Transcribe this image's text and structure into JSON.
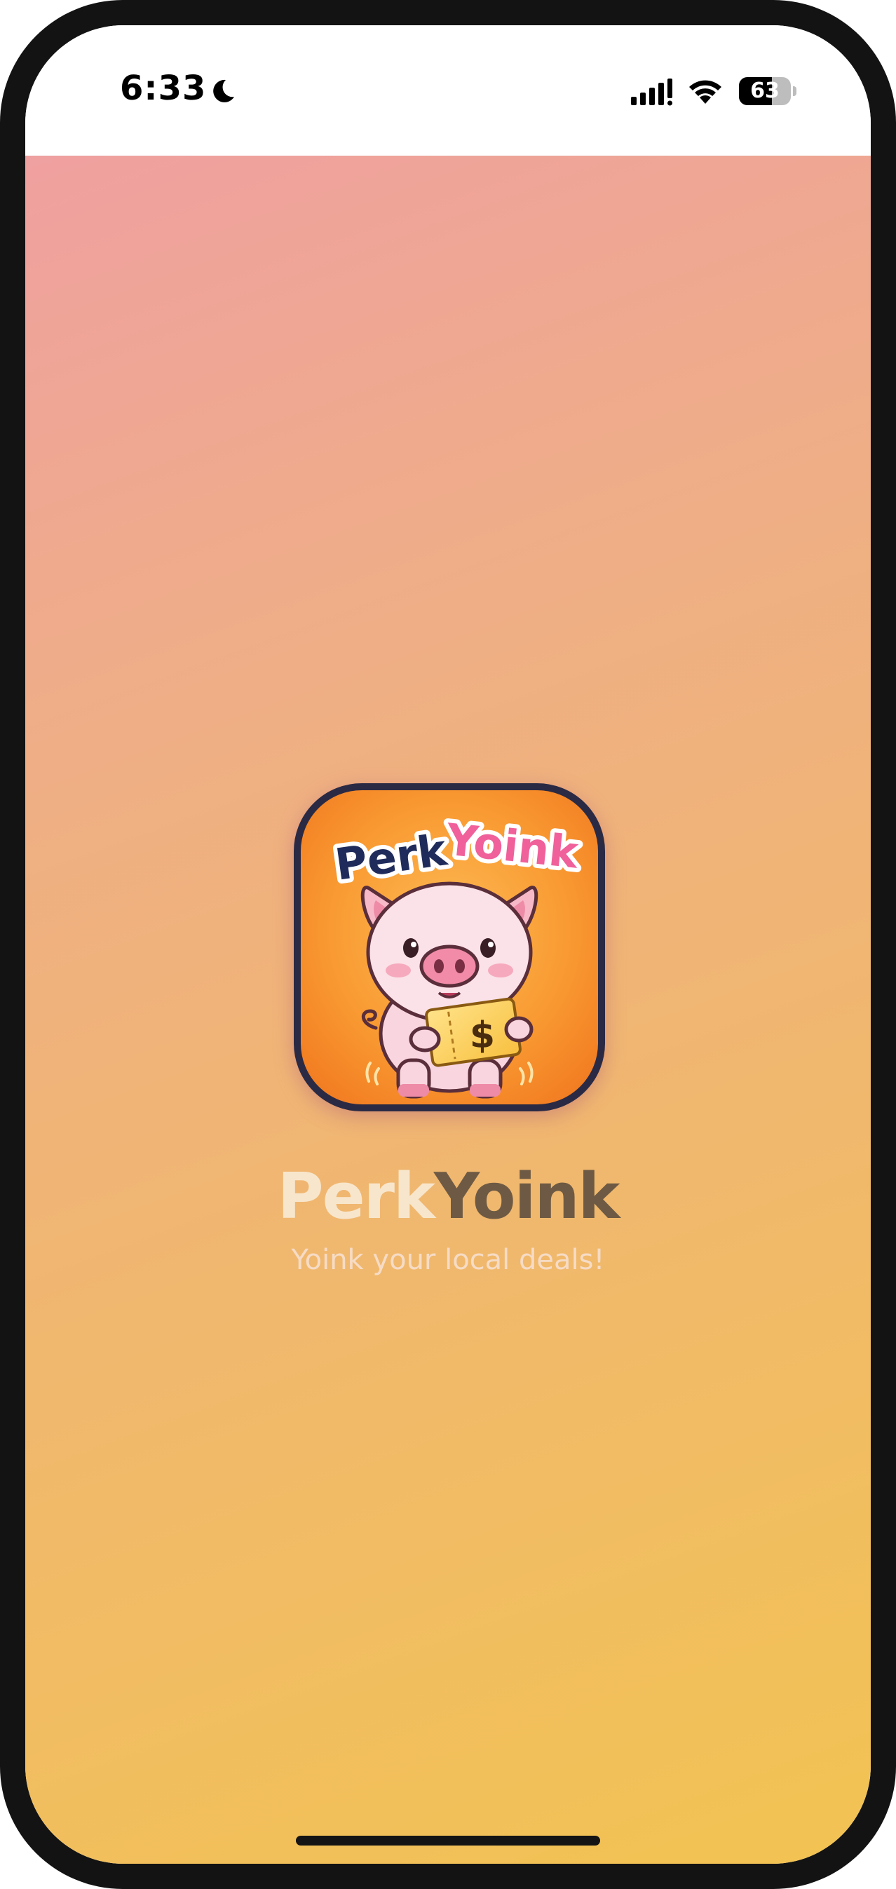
{
  "status_bar": {
    "time": "6:33",
    "battery_level": "63",
    "battery_fraction": 0.63,
    "icons": [
      "moon-icon",
      "cellular-signal-icon",
      "wifi-icon",
      "battery-icon"
    ]
  },
  "splash": {
    "app_icon": {
      "title_word_1": "Perk",
      "title_word_2": "Yoink",
      "coupon_symbol": "$"
    },
    "brand_part_1": "Perk",
    "brand_part_2": "Yoink",
    "tagline": "Yoink your local deals!",
    "colors": {
      "gradient_top": "#EFA0A0",
      "gradient_bottom": "#F2C352",
      "brand_light": "#F8E6CC",
      "brand_dark": "#6E5A44",
      "icon_border": "#2B2A44",
      "icon_orange": "#F59A2E"
    }
  }
}
